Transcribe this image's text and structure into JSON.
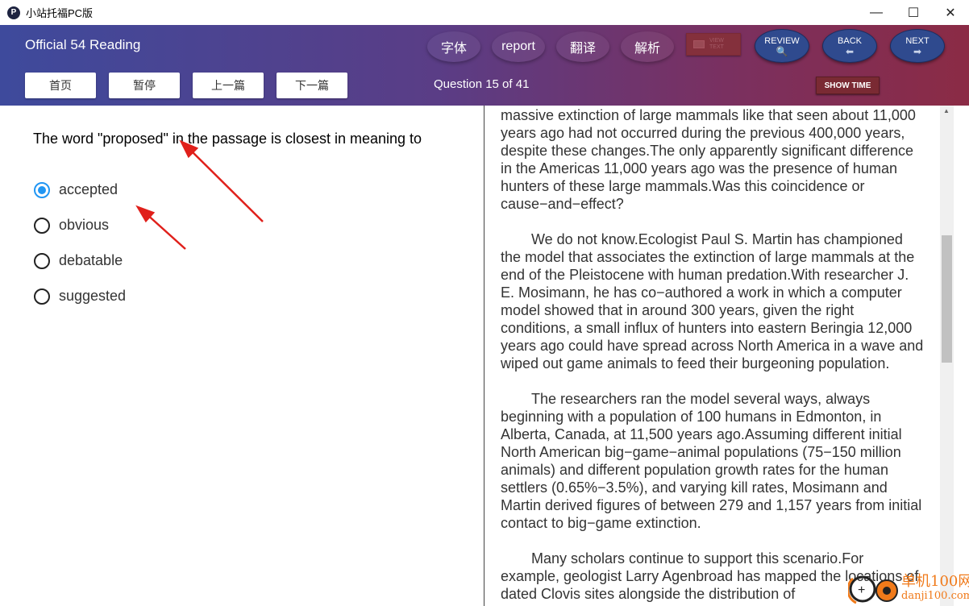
{
  "window": {
    "title": "小站托福PC版",
    "logo": "P",
    "min": "—",
    "max": "☐",
    "close": "✕"
  },
  "header": {
    "title": "Official 54 Reading",
    "nav": [
      "首页",
      "暂停",
      "上一篇",
      "下一篇"
    ],
    "pills": [
      "字体",
      "report",
      "翻译",
      "解析"
    ],
    "question_count": "Question 15 of 41",
    "view_text": [
      "VIEW",
      "TEXT"
    ],
    "review": "REVIEW",
    "back": "BACK",
    "next": "NEXT",
    "show_time": "SHOW TIME"
  },
  "question": {
    "text": "The word \"proposed\" in the passage is closest in meaning to",
    "options": [
      "accepted",
      "obvious",
      "debatable",
      "suggested"
    ],
    "selected": 0
  },
  "passage": {
    "paragraphs": [
      "massive extinction of large mammals like that seen about 11,000 years ago had not occurred during the previous 400,000 years, despite these changes.The only apparently significant difference in the Americas 11,000 years ago was the presence of human hunters of these large mammals.Was this coincidence or cause−and−effect?",
      "We do not know.Ecologist Paul S. Martin has championed the model that associates the extinction of large mammals at the end of the Pleistocene with human predation.With researcher J. E. Mosimann, he has co−authored a work in which a computer model showed that in around 300 years, given the right conditions, a small influx of hunters into eastern Beringia 12,000 years ago could have spread across North America in a wave and wiped out game animals to feed their burgeoning population.",
      "The researchers ran the model several ways, always beginning with a population of 100 humans in Edmonton, in Alberta, Canada, at 11,500 years ago.Assuming different initial North American big−game−animal populations (75−150 million animals) and different population growth rates for the human settlers (0.65%−3.5%), and varying kill rates, Mosimann and Martin derived figures of between 279 and 1,157 years from initial contact to big−game extinction.",
      "Many scholars continue to support this scenario.For example, geologist Larry Agenbroad has mapped the locations of dated Clovis sites alongside the distribution of"
    ]
  },
  "watermark": {
    "text": "单机100网",
    "url": "danji100.com"
  },
  "colors": {
    "accent": "#2196f3",
    "arrow": "#e0201b"
  }
}
